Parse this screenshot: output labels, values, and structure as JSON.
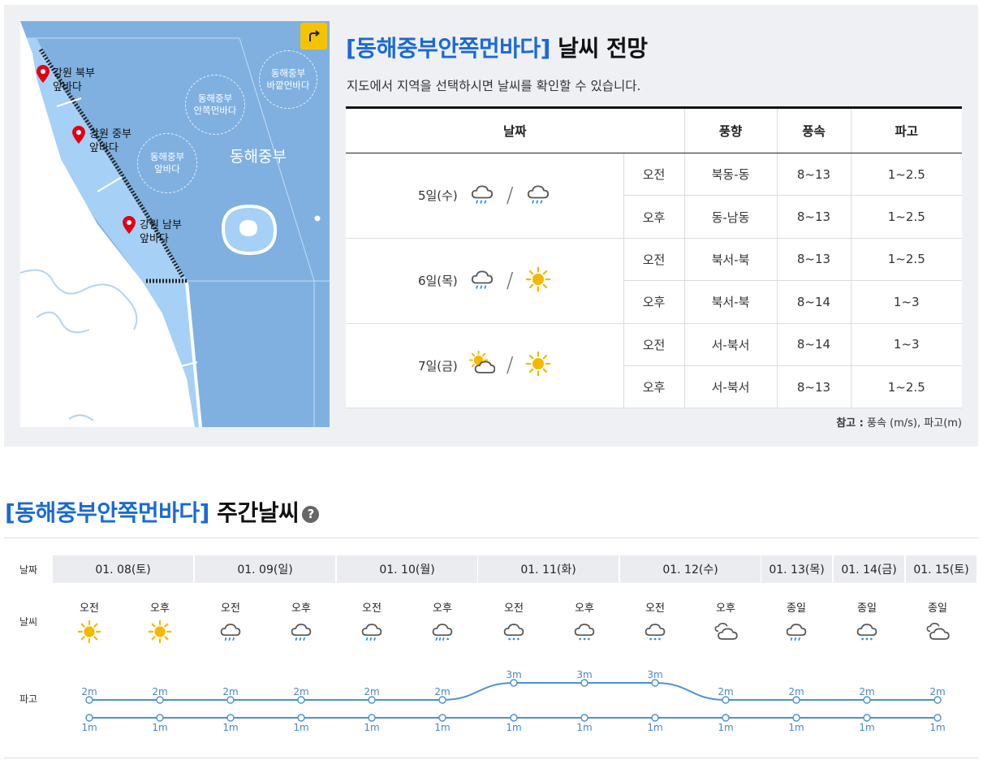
{
  "map": {
    "regions": [
      {
        "name": "강원 북부\n앞바다"
      },
      {
        "name": "강원 중부\n앞바다"
      },
      {
        "name": "강원 남부\n앞바다"
      }
    ],
    "zones": {
      "inner_near": "동해중부\n앞바다",
      "inner_far": "동해중부\n안쪽먼바다",
      "outer_far": "동해중부\n바깥먼바다",
      "big": "동해중부"
    },
    "share_icon": "share-arrow-icon"
  },
  "forecast": {
    "title_highlight": "[동해중부안쪽먼바다]",
    "title_rest": " 날씨 전망",
    "subtitle": "지도에서 지역을 선택하시면 날씨를 확인할 수 있습니다.",
    "headers": {
      "date": "날짜",
      "dir": "풍향",
      "speed": "풍속",
      "wave": "파고"
    },
    "days": [
      {
        "date": "5일(수)",
        "am_icon": "rain-icon",
        "pm_icon": "rain-icon",
        "am": {
          "label": "오전",
          "dir": "북동-동",
          "speed": "8~13",
          "wave": "1~2.5"
        },
        "pm": {
          "label": "오후",
          "dir": "동-남동",
          "speed": "8~13",
          "wave": "1~2.5"
        }
      },
      {
        "date": "6일(목)",
        "am_icon": "rain-icon",
        "pm_icon": "sun-icon",
        "am": {
          "label": "오전",
          "dir": "북서-북",
          "speed": "8~13",
          "wave": "1~2.5"
        },
        "pm": {
          "label": "오후",
          "dir": "북서-북",
          "speed": "8~14",
          "wave": "1~3"
        }
      },
      {
        "date": "7일(금)",
        "am_icon": "partly-cloudy-icon",
        "pm_icon": "sun-icon",
        "am": {
          "label": "오전",
          "dir": "서-북서",
          "speed": "8~14",
          "wave": "1~3"
        },
        "pm": {
          "label": "오후",
          "dir": "서-북서",
          "speed": "8~13",
          "wave": "1~2.5"
        }
      }
    ],
    "note_bold": "참고 :",
    "note_text": " 풍속 (m/s), 파고(m)"
  },
  "weekly": {
    "title_highlight": "[동해중부안쪽먼바다]",
    "title_rest": " 주간날씨",
    "help_icon": "?",
    "row_labels": {
      "date": "날짜",
      "weather": "날씨",
      "wave": "파고"
    },
    "dates": [
      "01. 08(토)",
      "01. 09(일)",
      "01. 10(월)",
      "01. 11(화)",
      "01. 12(수)",
      "01. 13(목)",
      "01. 14(금)",
      "01. 15(토)"
    ],
    "slots": [
      {
        "label": "오전",
        "icon": "sun-icon"
      },
      {
        "label": "오후",
        "icon": "sun-icon"
      },
      {
        "label": "오전",
        "icon": "rain-icon"
      },
      {
        "label": "오후",
        "icon": "rain-icon"
      },
      {
        "label": "오전",
        "icon": "rain-icon"
      },
      {
        "label": "오후",
        "icon": "rain-snow-icon"
      },
      {
        "label": "오전",
        "icon": "snow-icon"
      },
      {
        "label": "오후",
        "icon": "snow-icon"
      },
      {
        "label": "오전",
        "icon": "snow-icon"
      },
      {
        "label": "오후",
        "icon": "cloudy-icon"
      },
      {
        "label": "종일",
        "icon": "rain-icon"
      },
      {
        "label": "종일",
        "icon": "snow-icon"
      },
      {
        "label": "종일",
        "icon": "cloudy-icon"
      }
    ],
    "wave_unit": "m",
    "wave_max": [
      2,
      2,
      2,
      2,
      2,
      2,
      3,
      3,
      3,
      2,
      2,
      2,
      2
    ],
    "wave_min": [
      1,
      1,
      1,
      1,
      1,
      1,
      1,
      1,
      1,
      1,
      1,
      1,
      1
    ]
  }
}
